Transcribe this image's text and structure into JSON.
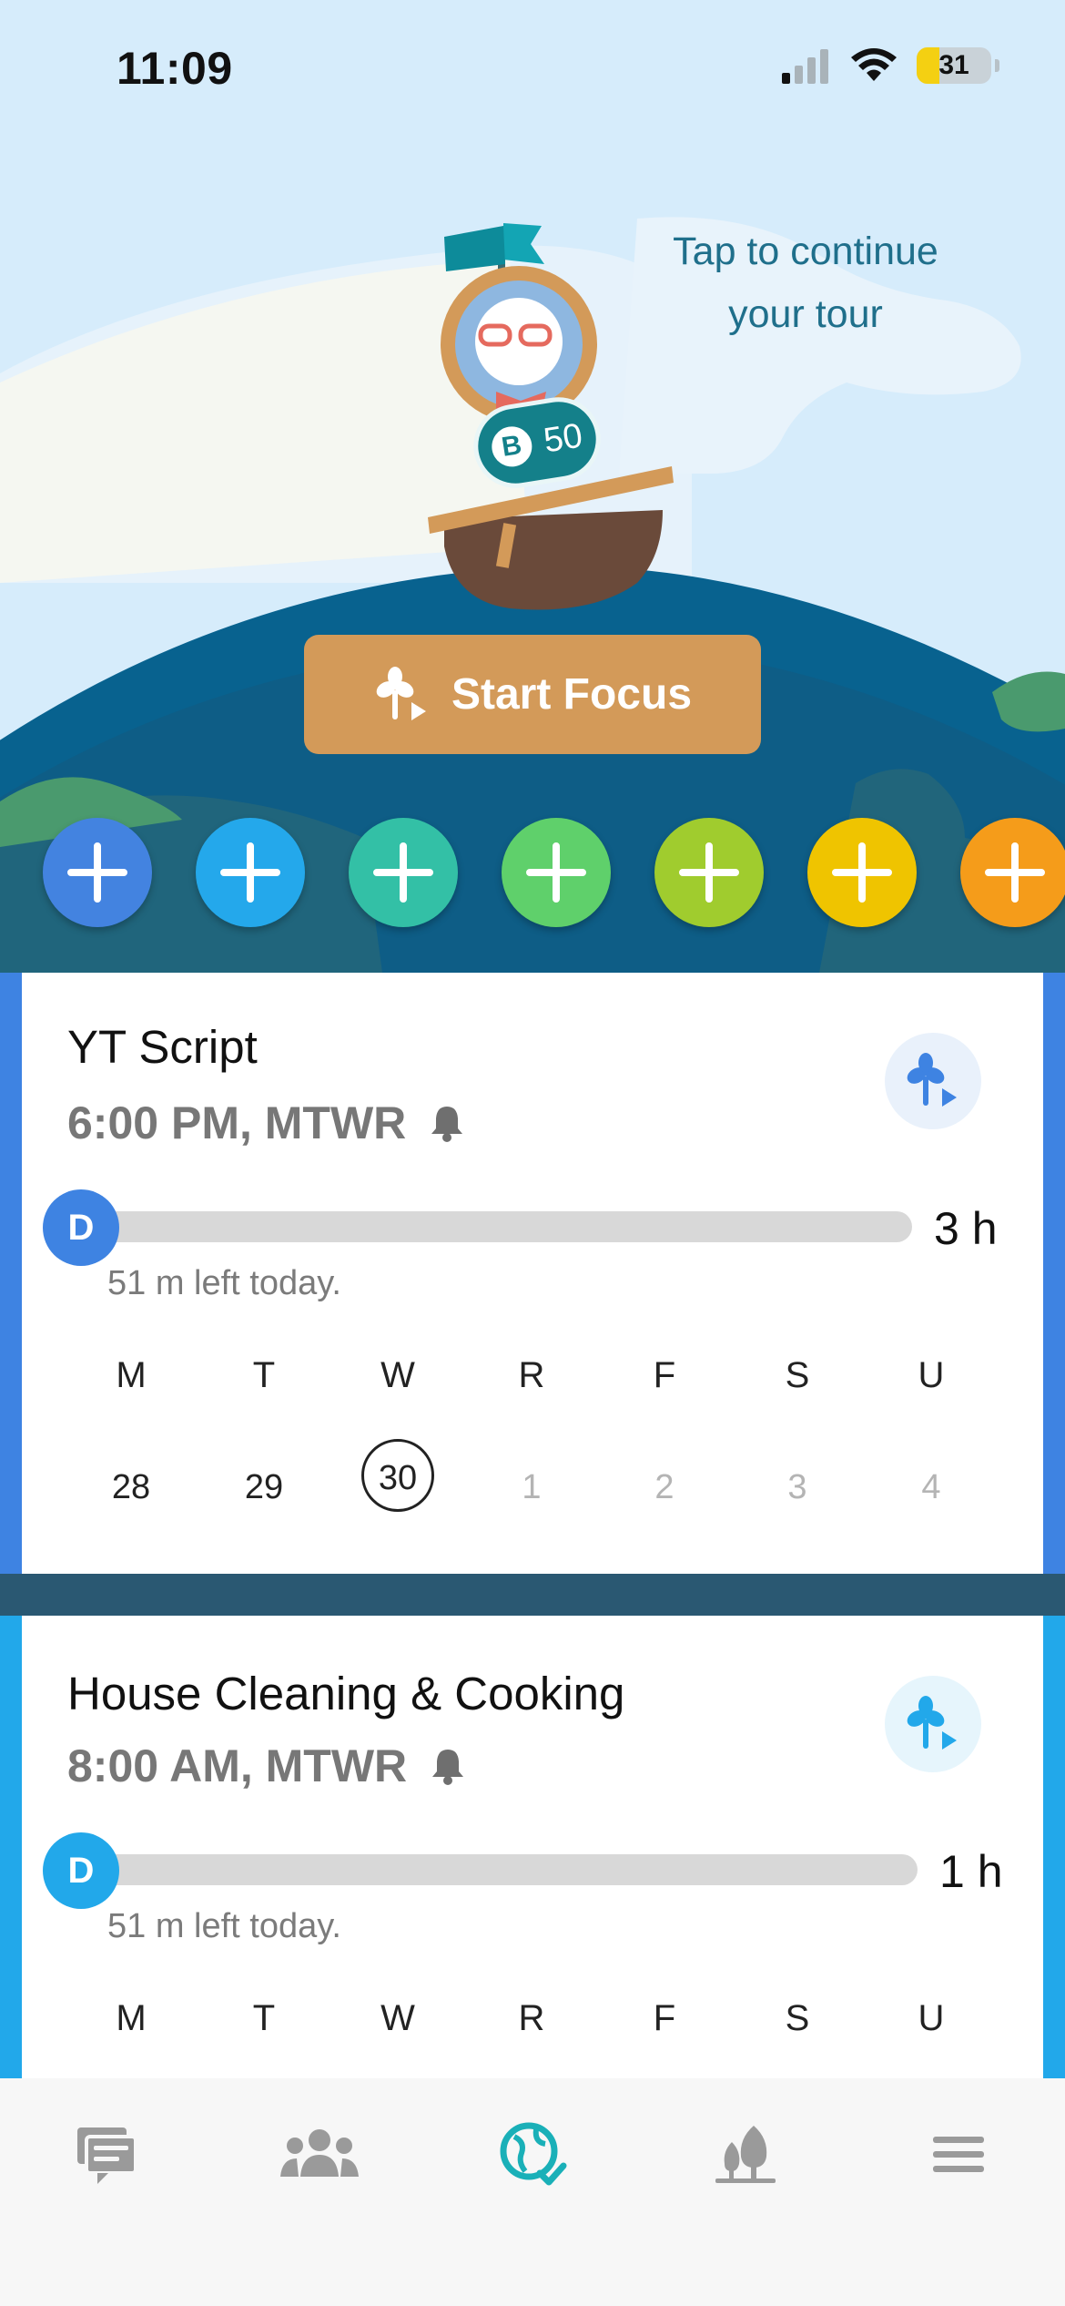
{
  "status_bar": {
    "time": "11:09",
    "battery": "31",
    "battery_level": 0.31
  },
  "hero": {
    "tour_hint_line1": "Tap to continue",
    "tour_hint_line2": "your tour",
    "coins": "50",
    "coin_icon_letter": "B",
    "start_focus_label": "Start Focus",
    "plus_colors": [
      "#4383e0",
      "#24a8eb",
      "#33c0a6",
      "#5fd06b",
      "#a0cc2e",
      "#efc400",
      "#f59c1a"
    ]
  },
  "tasks": [
    {
      "title": "YT Script",
      "schedule": "6:00 PM, MTWR",
      "accent": "#3e83e2",
      "avatar_letter": "D",
      "goal": "3 h",
      "remaining": "51 m left today.",
      "progress": 0,
      "days": [
        "M",
        "T",
        "W",
        "R",
        "F",
        "S",
        "U"
      ],
      "dates": [
        "28",
        "29",
        "30",
        "1",
        "2",
        "3",
        "4"
      ],
      "today_index": 2
    },
    {
      "title": "House Cleaning & Cooking",
      "schedule": "8:00 AM, MTWR",
      "accent": "#22a8ea",
      "avatar_letter": "D",
      "goal": "1 h",
      "remaining": "51 m left today.",
      "progress": 0,
      "days": [
        "M",
        "T",
        "W",
        "R",
        "F",
        "S",
        "U"
      ]
    }
  ],
  "tabbar": {
    "items": [
      {
        "icon": "chat-icon",
        "active": false
      },
      {
        "icon": "friends-icon",
        "active": false
      },
      {
        "icon": "globe-check-icon",
        "active": true
      },
      {
        "icon": "forest-icon",
        "active": false
      },
      {
        "icon": "menu-icon",
        "active": false
      }
    ],
    "active_color": "#1ab0b8",
    "inactive_color": "#9a9a9a"
  }
}
